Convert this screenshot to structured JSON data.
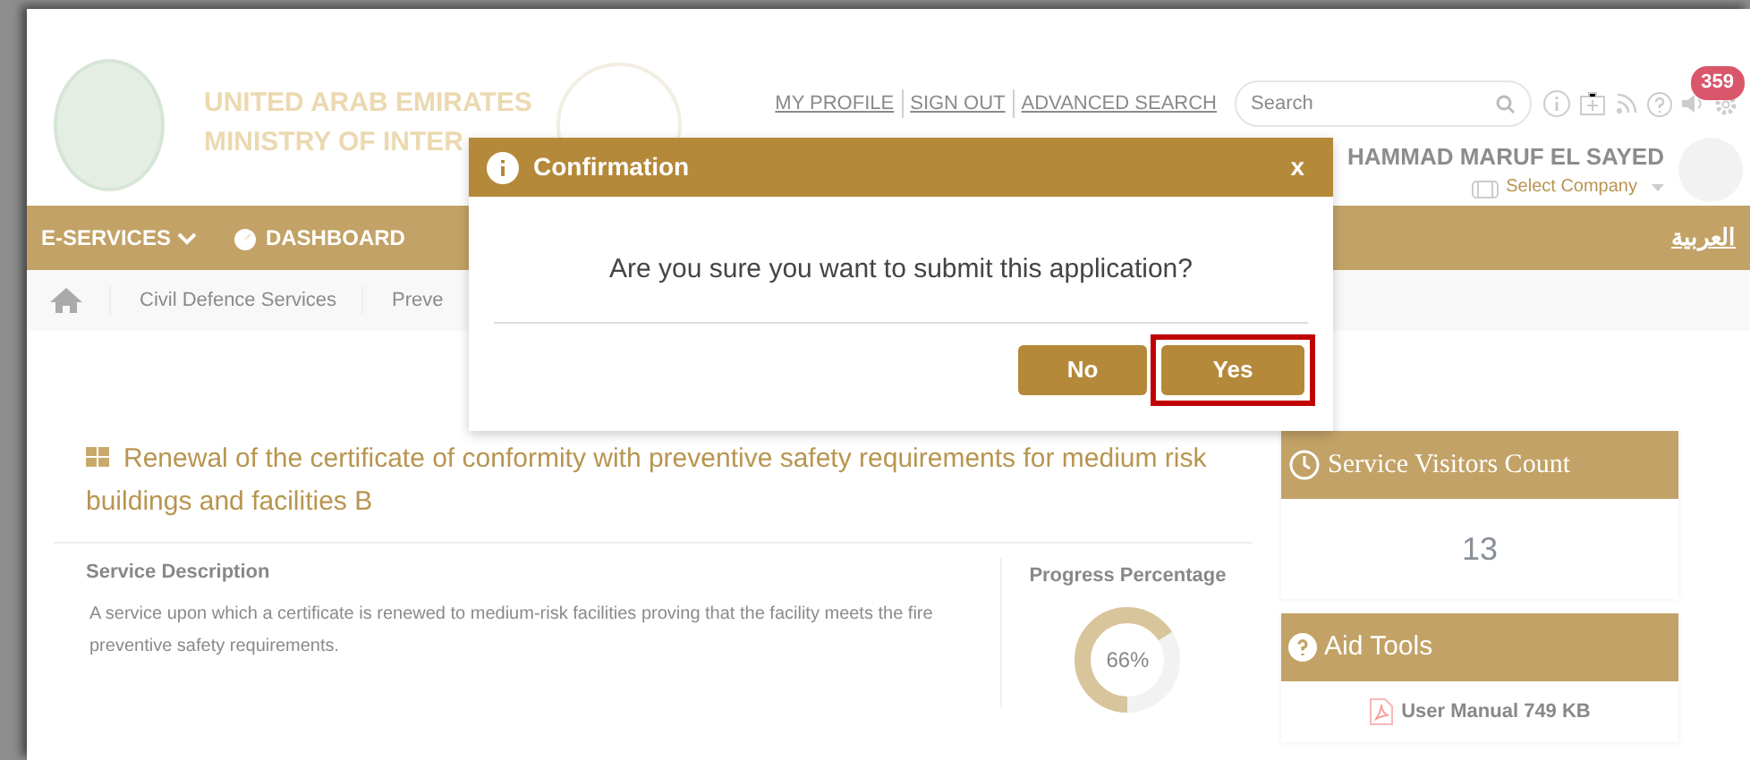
{
  "header": {
    "logo_lines": [
      "UNITED ARAB EMIRATES",
      "MINISTRY OF INTER"
    ],
    "top_links": [
      "MY PROFILE",
      "SIGN OUT",
      "ADVANCED SEARCH"
    ],
    "search": {
      "placeholder": "Search"
    },
    "notification_badge": "359",
    "user_name": "HAMMAD MARUF EL SAYED",
    "company_select": "Select Company"
  },
  "nav": {
    "items": [
      {
        "label": "E-SERVICES",
        "kind": "dropdown"
      },
      {
        "label": "DASHBOARD",
        "kind": "dashboard"
      }
    ],
    "language": "العربية"
  },
  "breadcrumb": [
    "Civil Defence Services",
    "Preve"
  ],
  "service": {
    "title": "Renewal of the certificate of conformity with preventive safety requirements for medium risk buildings and facilities B",
    "description_label": "Service Description",
    "description": "A service upon which a certificate is renewed to medium-risk facilities proving that the facility meets the fire preventive safety requirements.",
    "progress_label": "Progress Percentage",
    "progress_text": "66%",
    "level": 0.66
  },
  "side_panels": [
    {
      "kind": "visitors",
      "title": "Service Visitors Count",
      "value": "13"
    },
    {
      "kind": "tools",
      "title": "Aid Tools",
      "value": "User Manual 749 KB"
    }
  ],
  "dialog": {
    "title": "Confirmation",
    "close": "x",
    "message": "Are you sure you want to submit this application?",
    "buttons": [
      {
        "label": "No",
        "highlighted": false
      },
      {
        "label": "Yes",
        "highlighted": true
      }
    ]
  }
}
